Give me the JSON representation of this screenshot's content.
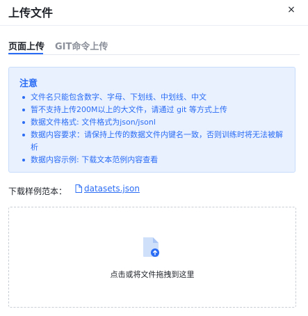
{
  "dialog": {
    "title": "上传文件",
    "close_glyph": "×"
  },
  "tabs": [
    {
      "label": "页面上传",
      "active": true
    },
    {
      "label": "GIT命令上传",
      "active": false
    }
  ],
  "notice": {
    "title": "注意",
    "items": [
      "文件名只能包含数字、字母、下划线、中划线、中文",
      "暂不支持上传200M以上的大文件，请通过 git 等方式上传",
      "数据文件格式: 文件格式为json/jsonl",
      "数据内容要求：请保持上传的数据文件内键名一致，否则训练时将无法被解析",
      "数据内容示例: 下载文本范例内容查看"
    ]
  },
  "sample": {
    "label": "下载样例范本：",
    "link_text": "datasets.json"
  },
  "dropzone": {
    "text": "点击或将文件拖拽到这里"
  },
  "colors": {
    "accent": "#2a6cf4",
    "notice_bg": "#e9f1ff",
    "notice_border": "#c7dcfb"
  },
  "icons": [
    "close-icon",
    "file-icon",
    "upload-file-icon"
  ]
}
